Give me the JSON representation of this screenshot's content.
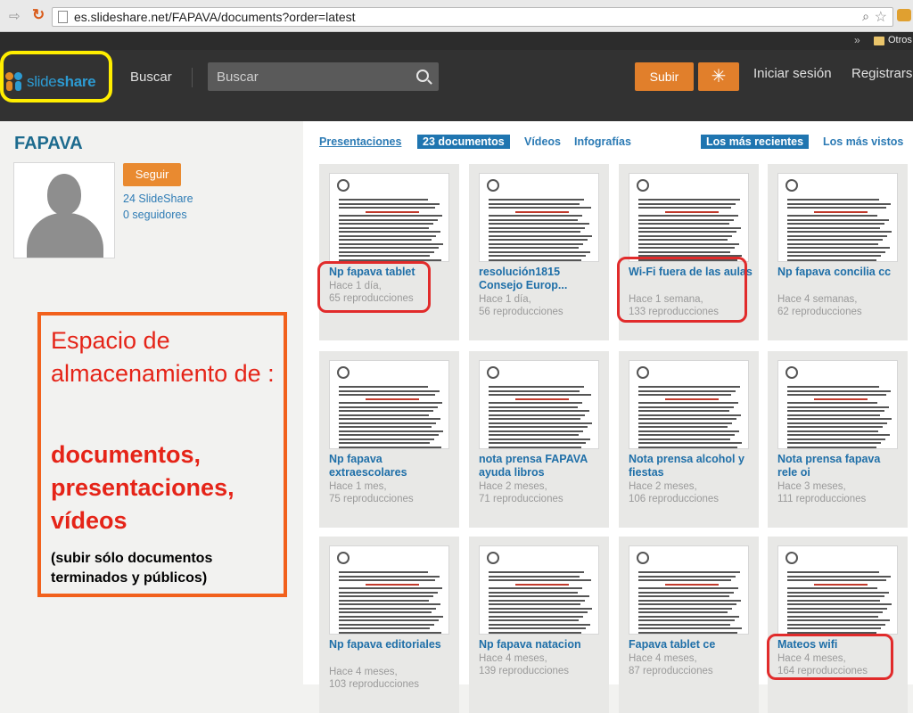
{
  "browser": {
    "url": "es.slideshare.net/FAPAVA/documents?order=latest",
    "bookmark_folder": "Otros"
  },
  "header": {
    "logo_text_light": "slide",
    "logo_text_bold": "share",
    "search_link": "Buscar",
    "search_placeholder": "Buscar",
    "upload_label": "Subir",
    "login_label": "Iniciar sesión",
    "register_label": "Registrars"
  },
  "profile": {
    "name": "FAPAVA",
    "follow_label": "Seguir",
    "slideshare_count": "24 SlideShare",
    "followers": "0 seguidores"
  },
  "annotation": {
    "line1": "Espacio de almacenamiento de :",
    "line2": "documentos, presentaciones, vídeos",
    "line3": "(subir sólo documentos terminados y públicos)"
  },
  "tabs": {
    "presentaciones": "Presentaciones",
    "documentos": "23 documentos",
    "videos": "Vídeos",
    "infografias": "Infografías",
    "recientes": "Los más recientes",
    "vistos": "Los más vistos"
  },
  "documents": [
    {
      "title": "Np fapava tablet",
      "age": "Hace 1 día,",
      "views": "65 reproducciones"
    },
    {
      "title": "resolución1815 Consejo Europ...",
      "age": "Hace 1 día,",
      "views": "56 reproducciones"
    },
    {
      "title": "Wi-Fi fuera de las aulas",
      "age": "Hace 1 semana,",
      "views": "133 reproducciones"
    },
    {
      "title": "Np fapava concilia cc",
      "age": "Hace 4 semanas,",
      "views": "62 reproducciones"
    },
    {
      "title": "Np fapava extraescolares",
      "age": "Hace 1 mes,",
      "views": "75 reproducciones"
    },
    {
      "title": "nota prensa FAPAVA ayuda libros",
      "age": "Hace 2 meses,",
      "views": "71 reproducciones"
    },
    {
      "title": "Nota prensa alcohol y fiestas",
      "age": "Hace 2 meses,",
      "views": "106 reproducciones"
    },
    {
      "title": "Nota prensa fapava rele oi",
      "age": "Hace 3 meses,",
      "views": "111 reproducciones"
    },
    {
      "title": "Np fapava editoriales",
      "age": "Hace 4 meses,",
      "views": "103 reproducciones"
    },
    {
      "title": "Np fapava natacion",
      "age": "Hace 4 meses,",
      "views": "139 reproducciones"
    },
    {
      "title": "Fapava tablet ce",
      "age": "Hace 4 meses,",
      "views": "87 reproducciones"
    },
    {
      "title": "Mateos wifi",
      "age": "Hace 4 meses,",
      "views": "164 reproducciones"
    }
  ]
}
